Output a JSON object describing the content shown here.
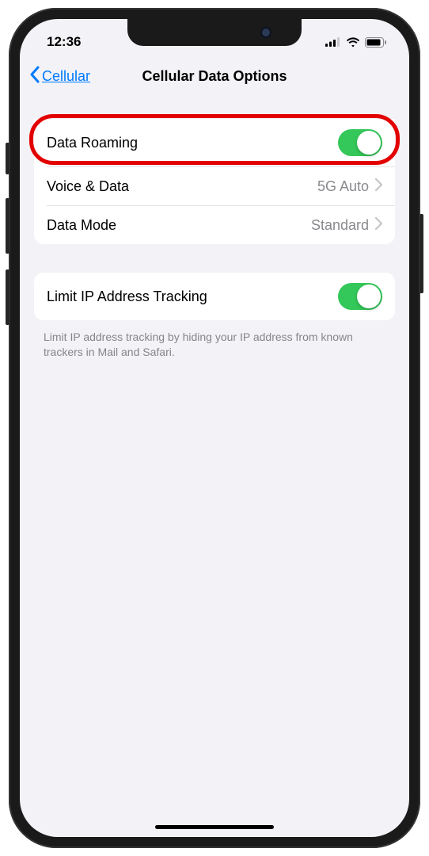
{
  "status": {
    "time": "12:36"
  },
  "nav": {
    "back_label": "Cellular",
    "title": "Cellular Data Options"
  },
  "group1": {
    "data_roaming": {
      "label": "Data Roaming",
      "on": true
    },
    "voice_data": {
      "label": "Voice & Data",
      "value": "5G Auto"
    },
    "data_mode": {
      "label": "Data Mode",
      "value": "Standard"
    }
  },
  "group2": {
    "limit_ip": {
      "label": "Limit IP Address Tracking",
      "on": true
    },
    "footer": "Limit IP address tracking by hiding your IP address from known trackers in Mail and Safari."
  }
}
